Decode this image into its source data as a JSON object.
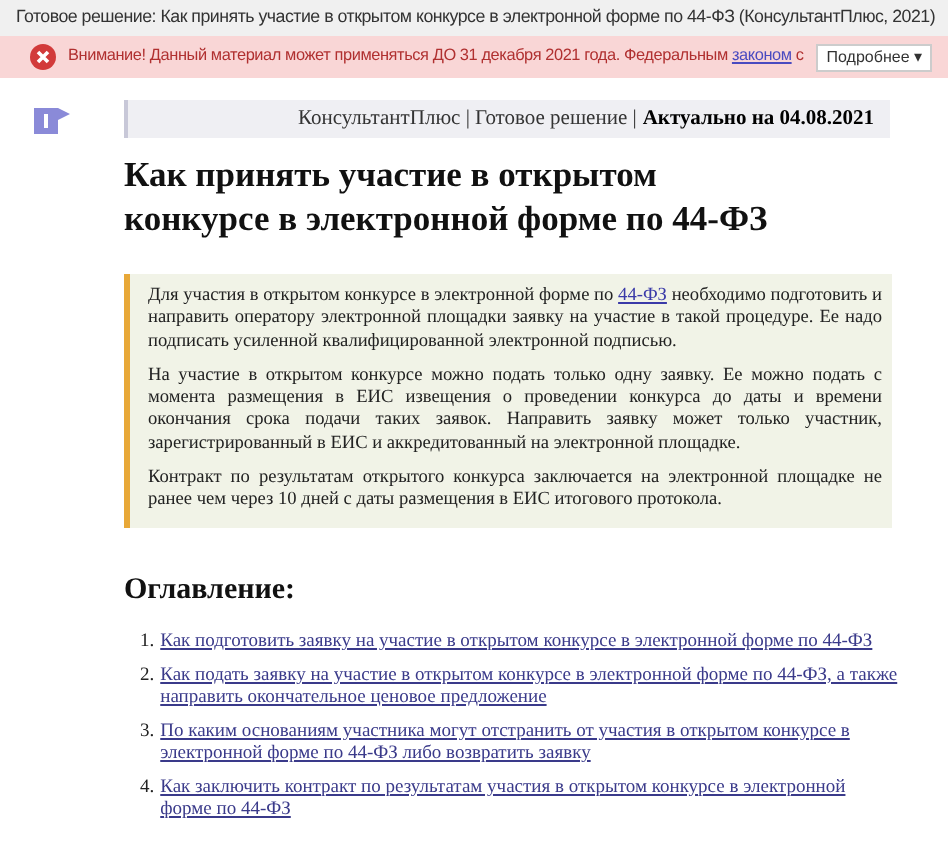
{
  "window": {
    "title": "Готовое решение: Как принять участие в открытом конкурсе в электронной форме по 44-ФЗ (КонсультантПлюс, 2021)"
  },
  "warning": {
    "before": "Внимание! Данный материал может применяться ДО 31 декабря 2021 года. Федеральным",
    "link": "законом",
    "after": "с",
    "button": "Подробнее ▾"
  },
  "header": {
    "source": "КонсультантПлюс | Готовое решение |",
    "actual": "Актуально на 04.08.2021"
  },
  "title": "Как принять участие в открытом конкурсе в электронной форме по 44-ФЗ",
  "summary": [
    {
      "before": "Для участия в открытом конкурсе в электронной форме по",
      "link": "44-ФЗ",
      "after": "необходимо подготовить и направить оператору электронной площадки заявку на участие в такой процедуре. Ее надо подписать усиленной квалифицированной электронной подписью."
    },
    {
      "before": "На участие в открытом конкурсе можно подать только одну заявку. Ее можно подать с момента размещения в ЕИС извещения о проведении конкурса до даты и времени окончания срока подачи таких заявок. Направить заявку может только участник, зарегистрированный в ЕИС и аккредитованный на электронной площадке."
    },
    {
      "before": "Контракт по результатам открытого конкурса заключается на электронной площадке не ранее чем через 10 дней с даты размещения в ЕИС итогового протокола."
    }
  ],
  "toc": {
    "heading": "Оглавление:",
    "items": [
      {
        "number": "1.",
        "text": "Как подготовить заявку на участие в открытом конкурсе в электронной форме по 44-ФЗ"
      },
      {
        "number": "2.",
        "text": "Как подать заявку на участие в открытом конкурсе в электронной форме по 44-ФЗ, а также направить окончательное ценовое предложение"
      },
      {
        "number": "3.",
        "text": "По каким основаниям участника могут отстранить от участия в открытом конкурсе в электронной форме по 44-ФЗ либо возвратить заявку"
      },
      {
        "number": "4.",
        "text": "Как заключить контракт по результатам участия в открытом конкурсе в электронной форме по 44-ФЗ"
      }
    ]
  }
}
